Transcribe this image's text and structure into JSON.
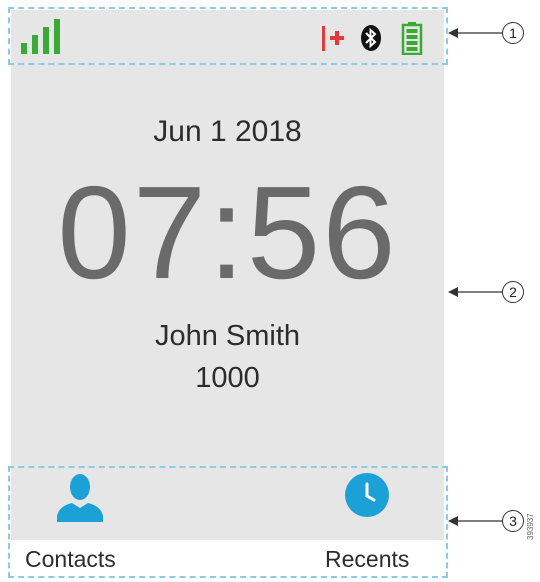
{
  "status_bar": {
    "signal_icon": "signal-strength-icon",
    "record_icon": "recording-icon",
    "bluetooth_icon": "bluetooth-icon",
    "battery_icon": "battery-icon",
    "signal_color": "#3aa935",
    "record_color": "#e03a3a",
    "battery_color": "#3aa935"
  },
  "main": {
    "date": "Jun 1 2018",
    "time": "07:56",
    "user_name": "John Smith",
    "extension": "1000"
  },
  "softkeys": {
    "contacts_label": "Contacts",
    "recents_label": "Recents",
    "contacts_icon": "contacts-person-icon",
    "recents_icon": "recents-clock-icon",
    "icon_color": "#1ba1d6"
  },
  "callouts": {
    "one": "1",
    "two": "2",
    "three": "3"
  },
  "figure_id": "393937"
}
